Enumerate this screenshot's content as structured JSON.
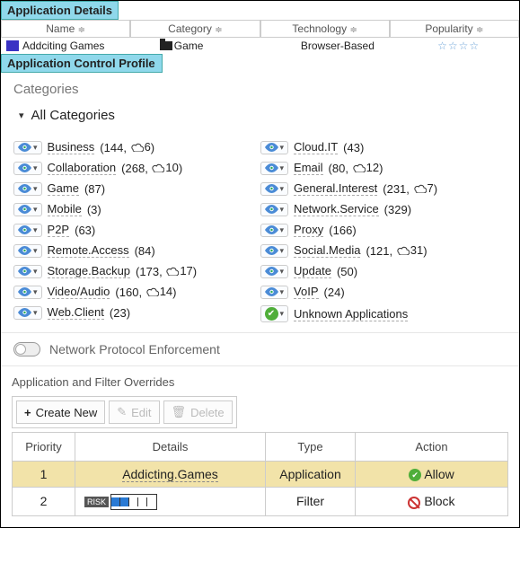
{
  "details": {
    "section_title": "Application Details",
    "columns": {
      "name": "Name",
      "category": "Category",
      "technology": "Technology",
      "popularity": "Popularity"
    },
    "row": {
      "name": "Addciting Games",
      "category": "Game",
      "technology": "Browser-Based",
      "popularity_stars": "☆☆☆☆"
    }
  },
  "profile": {
    "section_title": "Application Control Profile",
    "categories_heading": "Categories",
    "all_categories_label": "All Categories",
    "items_left": [
      {
        "name": "Business",
        "count": 144,
        "cloud": 6
      },
      {
        "name": "Collaboration",
        "count": 268,
        "cloud": 10
      },
      {
        "name": "Game",
        "count": 87
      },
      {
        "name": "Mobile",
        "count": 3
      },
      {
        "name": "P2P",
        "count": 63
      },
      {
        "name": "Remote.Access",
        "count": 84
      },
      {
        "name": "Storage.Backup",
        "count": 173,
        "cloud": 17
      },
      {
        "name": "Video/Audio",
        "count": 160,
        "cloud": 14
      },
      {
        "name": "Web.Client",
        "count": 23
      }
    ],
    "items_right": [
      {
        "name": "Cloud.IT",
        "count": 43
      },
      {
        "name": "Email",
        "count": 80,
        "cloud": 12
      },
      {
        "name": "General.Interest",
        "count": 231,
        "cloud": 7
      },
      {
        "name": "Network.Service",
        "count": 329
      },
      {
        "name": "Proxy",
        "count": 166
      },
      {
        "name": "Social.Media",
        "count": 121,
        "cloud": 31
      },
      {
        "name": "Update",
        "count": 50
      },
      {
        "name": "VoIP",
        "count": 24
      },
      {
        "name": "Unknown Applications",
        "unknown": true
      }
    ]
  },
  "npe": {
    "label": "Network Protocol Enforcement",
    "enabled": false
  },
  "overrides": {
    "title": "Application and Filter Overrides",
    "buttons": {
      "create": "Create New",
      "edit": "Edit",
      "delete": "Delete"
    },
    "columns": {
      "priority": "Priority",
      "details": "Details",
      "type": "Type",
      "action": "Action"
    },
    "rows": [
      {
        "priority": 1,
        "details_text": "Addicting.Games",
        "type": "Application",
        "action": "Allow",
        "selected": true
      },
      {
        "priority": 2,
        "details_risk": true,
        "type": "Filter",
        "action": "Block"
      }
    ]
  }
}
